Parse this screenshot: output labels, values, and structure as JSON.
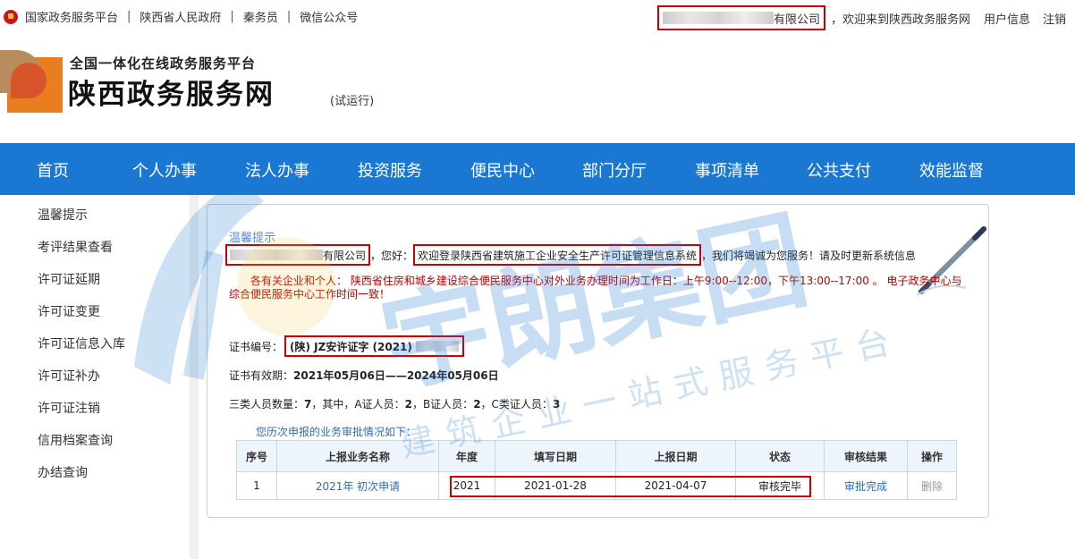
{
  "topbar": {
    "left_links": [
      "国家政务服务平台",
      "陕西省人民政府",
      "秦务员",
      "微信公众号"
    ],
    "separator": "|",
    "company_suffix": "有限公司",
    "welcome": "，欢迎来到陕西政务服务网",
    "user_info": "用户信息",
    "logout": "注销"
  },
  "header": {
    "subtitle": "全国一体化在线政务服务平台",
    "title": "陕西政务服务网",
    "trial": "(试运行)"
  },
  "nav": {
    "items": [
      "首页",
      "个人办事",
      "法人办事",
      "投资服务",
      "便民中心",
      "部门分厅",
      "事项清单",
      "公共支付",
      "效能监督"
    ]
  },
  "sidebar": {
    "items": [
      "温馨提示",
      "考评结果查看",
      "许可证延期",
      "许可证变更",
      "许可证信息入库",
      "许可证补办",
      "许可证注销",
      "信用档案查询",
      "办结查询"
    ]
  },
  "panel": {
    "title": "温馨提示",
    "company_suffix": "有限公司",
    "greeting": "，您好：",
    "system_welcome": "欢迎登录陕西省建筑施工企业安全生产许可证管理信息系统",
    "service_text": "，我们将竭诚为您服务！请及时更新系统信息",
    "notice": "各有关企业和个人： 陕西省住房和城乡建设综合便民服务中心对外业务办理时间为工作日：上午9:00--12:00，下午13:00--17:00 。 电子政务中心与综合便民服务中心工作时间一致！",
    "cert_label": "证书编号：",
    "cert_value": "(陕) JZ安许证字 (2021)",
    "valid_label": "证书有效期：",
    "valid_value": "2021年05月06日——2024年05月06日",
    "staff_label": "三类人员数量：",
    "staff_total": "7",
    "staff_detail_prefix": "，其中，A证人员：",
    "staff_a": "2",
    "staff_b_label": "，B证人员：",
    "staff_b": "2",
    "staff_c_label": "，C类证人员：",
    "staff_c": "3",
    "history_label": "您历次申报的业务审批情况如下："
  },
  "table": {
    "headers": [
      "序号",
      "上报业务名称",
      "年度",
      "填写日期",
      "上报日期",
      "状态",
      "审核结果",
      "操作"
    ],
    "row": {
      "index": "1",
      "name": "2021年 初次申请",
      "year": "2021",
      "fill_date": "2021-01-28",
      "report_date": "2021-04-07",
      "status": "审核完毕",
      "result": "审批完成",
      "action": "删除"
    }
  },
  "watermark": {
    "title": "宇朗集团",
    "slogan": "建筑企业一站式服务平台"
  },
  "colors": {
    "nav_bg": "#1a78d2",
    "highlight_border": "#cc0000",
    "notice_text": "#bb0000",
    "link_blue": "#2f6db5"
  }
}
